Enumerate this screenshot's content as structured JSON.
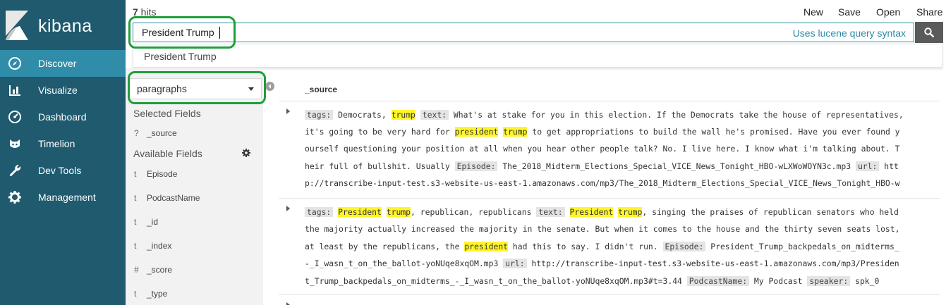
{
  "app": {
    "brand": "kibana"
  },
  "nav": [
    {
      "label": "Discover",
      "icon": "compass-icon"
    },
    {
      "label": "Visualize",
      "icon": "bar-chart-icon"
    },
    {
      "label": "Dashboard",
      "icon": "gauge-icon"
    },
    {
      "label": "Timelion",
      "icon": "cat-face-icon"
    },
    {
      "label": "Dev Tools",
      "icon": "wrench-icon"
    },
    {
      "label": "Management",
      "icon": "gear-icon"
    }
  ],
  "topbar": {
    "hits_count": "7",
    "hits_label": " hits",
    "actions": [
      "New",
      "Save",
      "Open",
      "Share"
    ]
  },
  "search": {
    "value": "President Trump",
    "syntax_link": "Uses lucene query syntax",
    "suggestion": "President Trump"
  },
  "fields_panel": {
    "index_pattern": "paragraphs",
    "selected_title": "Selected Fields",
    "selected": [
      {
        "type": "?",
        "name": "_source"
      }
    ],
    "available_title": "Available Fields",
    "available": [
      {
        "type": "t",
        "name": "Episode"
      },
      {
        "type": "t",
        "name": "PodcastName"
      },
      {
        "type": "t",
        "name": "_id"
      },
      {
        "type": "t",
        "name": "_index"
      },
      {
        "type": "#",
        "name": "_score"
      },
      {
        "type": "t",
        "name": "_type"
      }
    ]
  },
  "results": {
    "column": "_source",
    "docs": [
      {
        "lines": [
          [
            {
              "k": "tags:"
            },
            {
              "t": " Democrats, "
            },
            {
              "h": "trump"
            },
            {
              "t": " "
            },
            {
              "k": "text:"
            },
            {
              "t": " What's at stake for you in this election. If the Democrats take the house of representatives,"
            }
          ],
          [
            {
              "t": "it's going to be very hard for "
            },
            {
              "h": "president"
            },
            {
              "t": " "
            },
            {
              "h": "trump"
            },
            {
              "t": " to get appropriations to build the wall he's promised. Have you ever found y"
            }
          ],
          [
            {
              "t": "ourself questioning your position at all when you hear other people talk? No. I live here. I know what i'm talking about. T"
            }
          ],
          [
            {
              "t": "heir full of bullshit. Usually "
            },
            {
              "k": "Episode:"
            },
            {
              "t": " The_2018_Midterm_Elections_Special_VICE_News_Tonight_HBO-wLXWoWOYN3c.mp3 "
            },
            {
              "k": "url:"
            },
            {
              "t": " htt"
            }
          ],
          [
            {
              "t": "p://transcribe-input-test.s3-website-us-east-1.amazonaws.com/mp3/The_2018_Midterm_Elections_Special_VICE_News_Tonight_HBO-w"
            }
          ]
        ]
      },
      {
        "lines": [
          [
            {
              "k": "tags:"
            },
            {
              "t": " "
            },
            {
              "h": "President"
            },
            {
              "t": " "
            },
            {
              "h": "trump"
            },
            {
              "t": ", republican, republicans "
            },
            {
              "k": "text:"
            },
            {
              "t": " "
            },
            {
              "h": "President"
            },
            {
              "t": " "
            },
            {
              "h": "trump"
            },
            {
              "t": ", singing the praises of republican senators who held"
            }
          ],
          [
            {
              "t": "the majority actually increased the majority in the senate. But when it comes to the house and the thirty seven seats lost,"
            }
          ],
          [
            {
              "t": "at least by the republicans, the "
            },
            {
              "h": "president"
            },
            {
              "t": " had this to say. I didn't run. "
            },
            {
              "k": "Episode:"
            },
            {
              "t": " President_Trump_backpedals_on_midterms_"
            }
          ],
          [
            {
              "t": "-_I_wasn_t_on_the_ballot-yoNUqe8xqOM.mp3 "
            },
            {
              "k": "url:"
            },
            {
              "t": " http://transcribe-input-test.s3-website-us-east-1.amazonaws.com/mp3/Presiden"
            }
          ],
          [
            {
              "t": "t_Trump_backpedals_on_midterms_-_I_wasn_t_on_the_ballot-yoNUqe8xqOM.mp3#t=3.44 "
            },
            {
              "k": "PodcastName:"
            },
            {
              "t": " My Podcast "
            },
            {
              "k": "speaker:"
            },
            {
              "t": " spk_0"
            }
          ]
        ]
      }
    ]
  },
  "colors": {
    "sidebar": "#1f5a6e",
    "active": "#2f8daa",
    "accent": "#2b8aa6",
    "highlight": "#fff52a",
    "annotation": "#1f9e3a"
  }
}
